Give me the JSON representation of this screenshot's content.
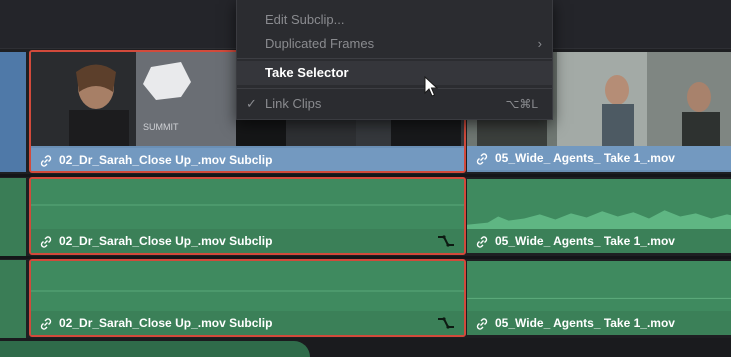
{
  "context_menu": {
    "items": [
      {
        "label": "Edit Subclip...",
        "state": "disabled"
      },
      {
        "label": "Duplicated Frames",
        "state": "disabled",
        "submenu_icon": "chevron-right-icon"
      },
      {
        "label": "Take Selector",
        "state": "highlighted"
      },
      {
        "label": "Link Clips",
        "state": "checked-disabled",
        "check": "✓",
        "shortcut": "⌥⌘L"
      }
    ]
  },
  "timeline": {
    "video_track": {
      "clips": [
        {
          "label": "02_Dr_Sarah_Close Up_.mov Subclip",
          "selected": true
        },
        {
          "label": "05_Wide_ Agents_ Take 1_.mov",
          "selected": false
        }
      ]
    },
    "audio_track_1": {
      "clips": [
        {
          "label": "02_Dr_Sarah_Close Up_.mov Subclip",
          "selected": true,
          "fx_icon": "curve-icon"
        },
        {
          "label": "05_Wide_ Agents_ Take 1_.mov",
          "selected": false
        }
      ]
    },
    "audio_track_2": {
      "clips": [
        {
          "label": "02_Dr_Sarah_Close Up_.mov Subclip",
          "selected": true,
          "fx_icon": "curve-icon"
        },
        {
          "label": "05_Wide_ Agents_ Take 1_.mov",
          "selected": false
        }
      ]
    }
  },
  "colors": {
    "selection_border": "#d24a3b",
    "video_clip": "#6a8fb5",
    "audio_clip": "#3f8a5f",
    "menu_bg": "#2b2c30"
  }
}
